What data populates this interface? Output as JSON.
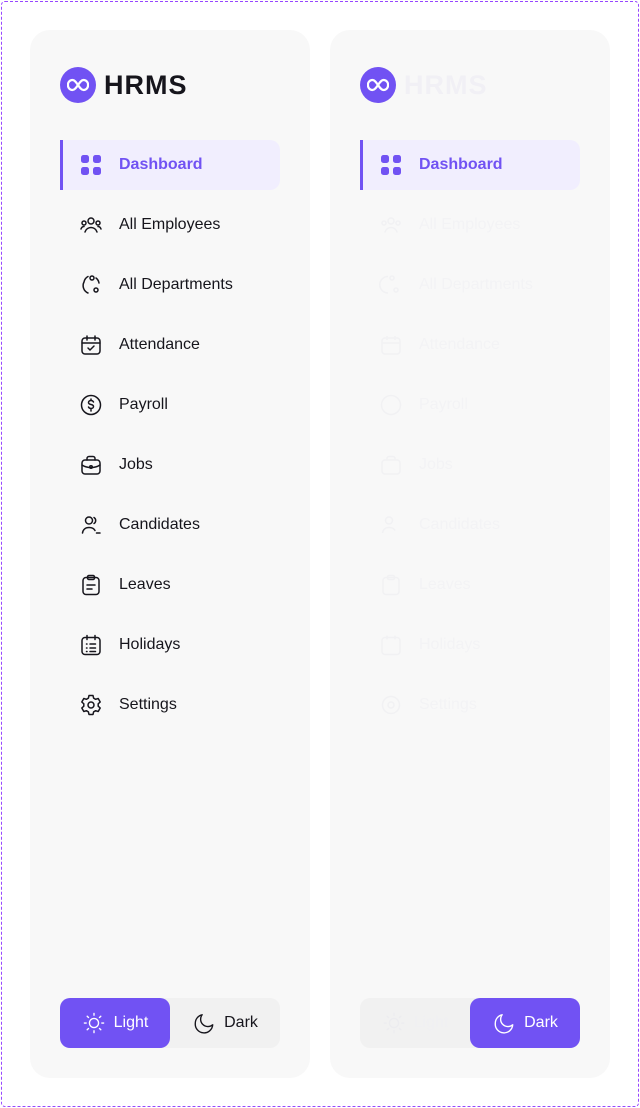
{
  "brand": {
    "name": "HRMS"
  },
  "colors": {
    "accent": "#7152f3",
    "panel_bg": "#f8f8f8",
    "active_bg": "#f1eefe",
    "text": "#16151c"
  },
  "nav": {
    "items": [
      {
        "label": "Dashboard",
        "icon": "dashboard-icon",
        "active": true
      },
      {
        "label": "All Employees",
        "icon": "users-icon"
      },
      {
        "label": "All Departments",
        "icon": "departments-icon"
      },
      {
        "label": "Attendance",
        "icon": "calendar-check-icon"
      },
      {
        "label": "Payroll",
        "icon": "dollar-circle-icon"
      },
      {
        "label": "Jobs",
        "icon": "briefcase-icon"
      },
      {
        "label": "Candidates",
        "icon": "candidates-icon"
      },
      {
        "label": "Leaves",
        "icon": "clipboard-icon"
      },
      {
        "label": "Holidays",
        "icon": "calendar-list-icon"
      },
      {
        "label": "Settings",
        "icon": "gear-icon"
      }
    ]
  },
  "theme": {
    "light_label": "Light",
    "dark_label": "Dark"
  },
  "panels": [
    {
      "variant": "light",
      "selected_theme": "light"
    },
    {
      "variant": "dark",
      "selected_theme": "dark"
    }
  ]
}
